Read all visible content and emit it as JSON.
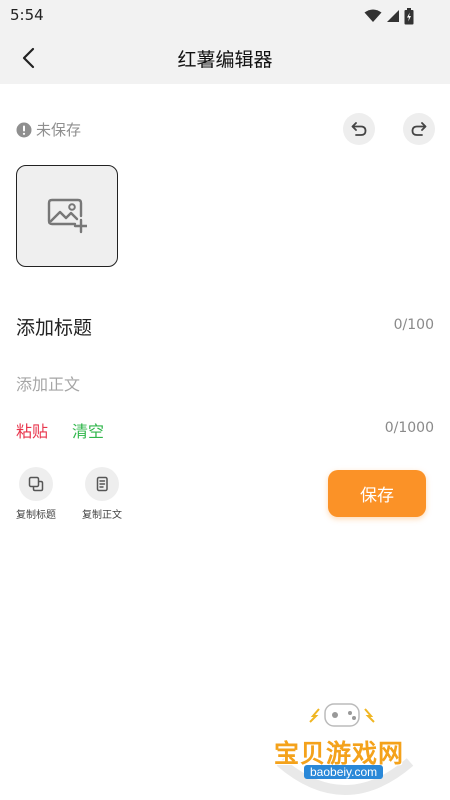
{
  "status_bar": {
    "time": "5:54"
  },
  "header": {
    "title": "红薯编辑器"
  },
  "editor": {
    "save_status": "未保存",
    "title_placeholder": "添加标题",
    "title_count": "0/100",
    "body_placeholder": "添加正文",
    "body_count": "0/1000",
    "paste_label": "粘贴",
    "clear_label": "清空"
  },
  "tools": {
    "copy_title_label": "复制标题",
    "copy_body_label": "复制正文"
  },
  "actions": {
    "save_label": "保存"
  },
  "watermark": {
    "name": "宝贝游戏网",
    "url": "baobeiy.com"
  },
  "colors": {
    "accent": "#fb9227",
    "paste": "#e8344b",
    "clear": "#2fb64a",
    "muted": "#8f8f8f"
  }
}
